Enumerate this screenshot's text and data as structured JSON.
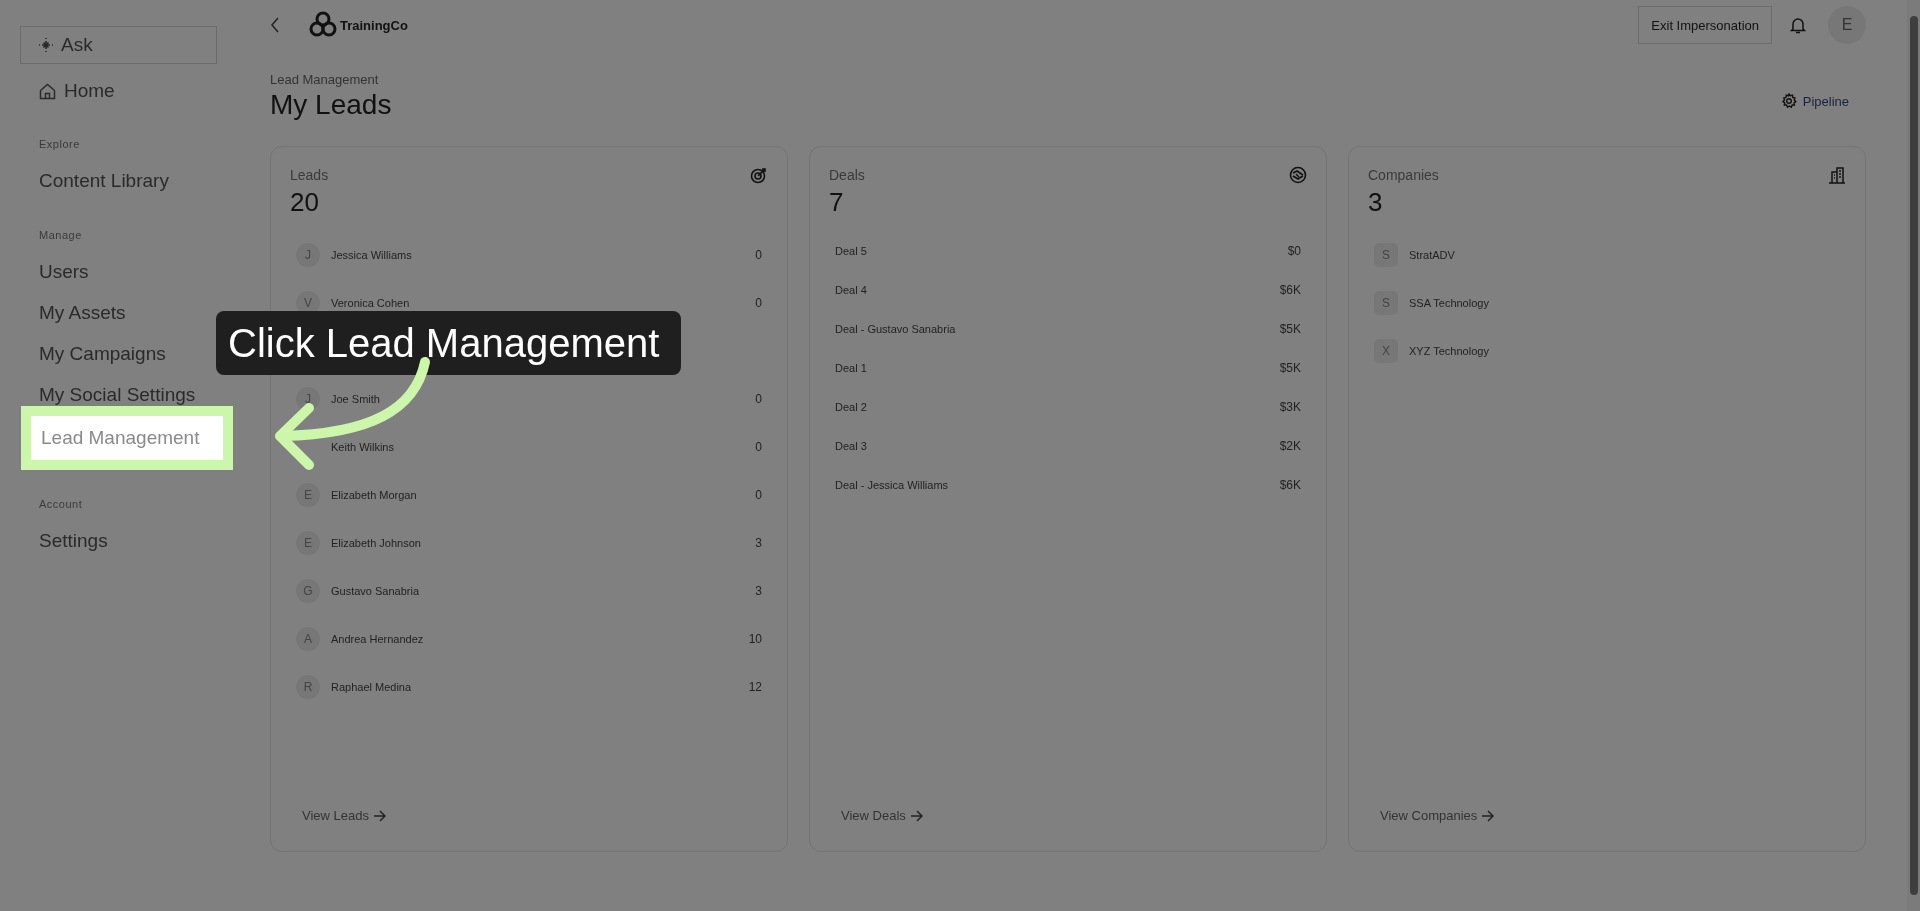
{
  "sidebar": {
    "ask_button": "Ask",
    "home": "Home",
    "sections": [
      {
        "heading": "Explore",
        "items": [
          {
            "label": "Content Library",
            "selected": false
          }
        ]
      },
      {
        "heading": "Manage",
        "items": [
          {
            "label": "Users",
            "selected": false
          },
          {
            "label": "My Assets",
            "selected": false
          },
          {
            "label": "My Campaigns",
            "selected": false
          },
          {
            "label": "My Social Settings",
            "selected": false
          },
          {
            "label": "Lead Management",
            "selected": true
          }
        ]
      },
      {
        "heading": "Account",
        "items": [
          {
            "label": "Settings",
            "selected": false
          }
        ]
      }
    ]
  },
  "header": {
    "logo": "TrainingCo",
    "exit_button": "Exit Impersonation",
    "avatar": "E"
  },
  "page": {
    "breadcrumb": "Lead Management",
    "title": "My Leads",
    "pipeline_button": "Pipeline"
  },
  "cards": [
    {
      "kind": "leads",
      "title": "Leads",
      "count": "20",
      "link": "View Leads",
      "rows": [
        {
          "kind": "person",
          "initial": "J",
          "name": "Jessica Williams",
          "value": "0"
        },
        {
          "kind": "person",
          "initial": "V",
          "name": "Veronica Cohen",
          "value": "0"
        },
        {
          "kind": "covered"
        },
        {
          "kind": "person",
          "initial": "J",
          "name": "Joe Smith",
          "value": "0"
        },
        {
          "kind": "person",
          "name": "Keith Wilkins",
          "value": "0"
        },
        {
          "kind": "person",
          "initial": "E",
          "name": "Elizabeth Morgan",
          "value": "0"
        },
        {
          "kind": "person",
          "initial": "E",
          "name": "Elizabeth Johnson",
          "value": "3"
        },
        {
          "kind": "person",
          "initial": "G",
          "name": "Gustavo Sanabria",
          "value": "3"
        },
        {
          "kind": "person",
          "initial": "A",
          "name": "Andrea Hernandez",
          "value": "10"
        },
        {
          "kind": "person",
          "initial": "R",
          "name": "Raphael Medina",
          "value": "12"
        }
      ]
    },
    {
      "kind": "deals",
      "title": "Deals",
      "count": "7",
      "link": "View Deals",
      "rows": [
        {
          "kind": "deal",
          "name": "Deal 5",
          "value": "$0"
        },
        {
          "kind": "deal",
          "name": "Deal 4",
          "value": "$6K"
        },
        {
          "kind": "deal",
          "name": "Deal - Gustavo Sanabria",
          "value": "$5K"
        },
        {
          "kind": "deal",
          "name": "Deal 1",
          "value": "$5K"
        },
        {
          "kind": "deal",
          "name": "Deal 2",
          "value": "$3K"
        },
        {
          "kind": "deal",
          "name": "Deal 3",
          "value": "$2K"
        },
        {
          "kind": "deal",
          "name": "Deal - Jessica Williams",
          "value": "$6K"
        }
      ]
    },
    {
      "kind": "companies",
      "title": "Companies",
      "count": "3",
      "link": "View Companies",
      "rows": [
        {
          "kind": "company",
          "initial": "S",
          "name": "StratADV"
        },
        {
          "kind": "company",
          "initial": "S",
          "name": "SSA Technology"
        },
        {
          "kind": "company",
          "initial": "X",
          "name": "XYZ Technology"
        }
      ]
    }
  ],
  "tutorial": {
    "text": "Click Lead Management"
  }
}
